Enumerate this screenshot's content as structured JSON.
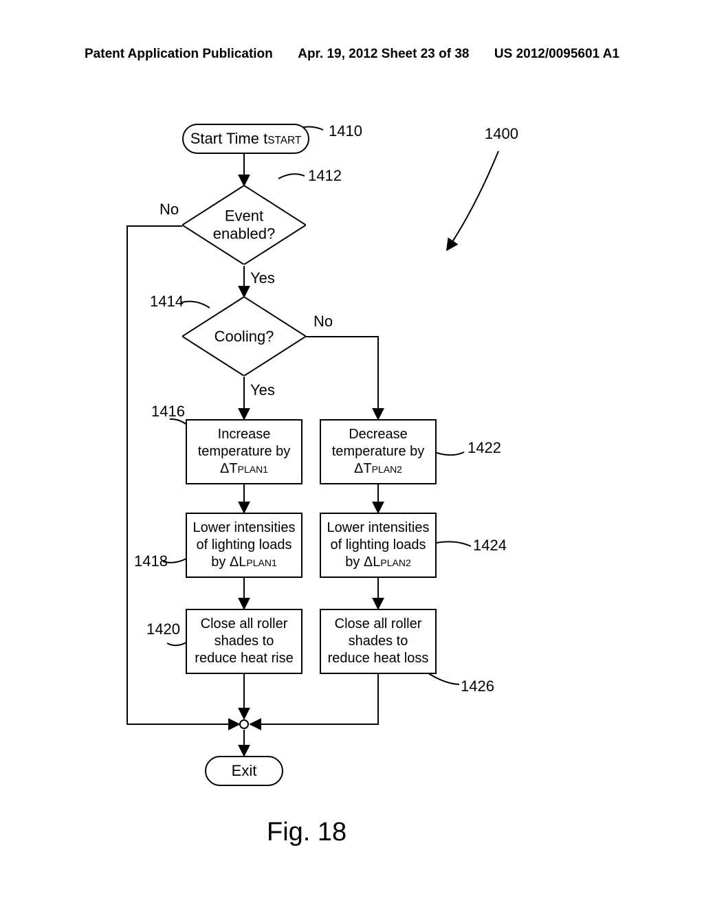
{
  "header": {
    "left": "Patent Application Publication",
    "mid": "Apr. 19, 2012  Sheet 23 of 38",
    "right": "US 2012/0095601 A1"
  },
  "refs": {
    "r1400": "1400",
    "r1410": "1410",
    "r1412": "1412",
    "r1414": "1414",
    "r1416": "1416",
    "r1418": "1418",
    "r1420": "1420",
    "r1422": "1422",
    "r1424": "1424",
    "r1426": "1426"
  },
  "edge_labels": {
    "event_no": "No",
    "event_yes": "Yes",
    "cooling_no": "No",
    "cooling_yes": "Yes"
  },
  "nodes": {
    "start_prefix": "Start Time t",
    "start_sub": "START",
    "event": "Event\nenabled?",
    "cooling": "Cooling?",
    "increase_l1": "Increase",
    "increase_l2": "temperature by",
    "increase_l3a": "ΔT",
    "increase_l3b": "PLAN1",
    "decrease_l1": "Decrease",
    "decrease_l2": "temperature by",
    "decrease_l3a": "ΔT",
    "decrease_l3b": "PLAN2",
    "lower1_l1": "Lower intensities",
    "lower1_l2": "of lighting loads",
    "lower1_l3a": "by ΔL",
    "lower1_l3b": "PLAN1",
    "lower2_l1": "Lower intensities",
    "lower2_l2": "of lighting loads",
    "lower2_l3a": "by ΔL",
    "lower2_l3b": "PLAN2",
    "close1_l1": "Close all roller",
    "close1_l2": "shades to",
    "close1_l3": "reduce heat rise",
    "close2_l1": "Close all roller",
    "close2_l2": "shades to",
    "close2_l3": "reduce heat loss",
    "exit": "Exit"
  },
  "figure_caption": "Fig. 18",
  "chart_data": {
    "type": "flowchart",
    "title": "Fig. 18",
    "figure_ref": "1400",
    "nodes": [
      {
        "id": "1410",
        "type": "terminal",
        "label": "Start Time t_START"
      },
      {
        "id": "1412",
        "type": "decision",
        "label": "Event enabled?"
      },
      {
        "id": "1414",
        "type": "decision",
        "label": "Cooling?"
      },
      {
        "id": "1416",
        "type": "process",
        "label": "Increase temperature by ΔT_PLAN1"
      },
      {
        "id": "1418",
        "type": "process",
        "label": "Lower intensities of lighting loads by ΔL_PLAN1"
      },
      {
        "id": "1420",
        "type": "process",
        "label": "Close all roller shades to reduce heat rise"
      },
      {
        "id": "1422",
        "type": "process",
        "label": "Decrease temperature by ΔT_PLAN2"
      },
      {
        "id": "1424",
        "type": "process",
        "label": "Lower intensities of lighting loads by ΔL_PLAN2"
      },
      {
        "id": "1426",
        "type": "process",
        "label": "Close all roller shades to reduce heat loss"
      },
      {
        "id": "junction",
        "type": "junction",
        "label": ""
      },
      {
        "id": "exit",
        "type": "terminal",
        "label": "Exit"
      }
    ],
    "edges": [
      {
        "from": "1410",
        "to": "1412",
        "label": ""
      },
      {
        "from": "1412",
        "to": "1414",
        "label": "Yes"
      },
      {
        "from": "1412",
        "to": "junction",
        "label": "No"
      },
      {
        "from": "1414",
        "to": "1416",
        "label": "Yes"
      },
      {
        "from": "1414",
        "to": "1422",
        "label": "No"
      },
      {
        "from": "1416",
        "to": "1418",
        "label": ""
      },
      {
        "from": "1418",
        "to": "1420",
        "label": ""
      },
      {
        "from": "1420",
        "to": "junction",
        "label": ""
      },
      {
        "from": "1422",
        "to": "1424",
        "label": ""
      },
      {
        "from": "1424",
        "to": "1426",
        "label": ""
      },
      {
        "from": "1426",
        "to": "junction",
        "label": ""
      },
      {
        "from": "junction",
        "to": "exit",
        "label": ""
      }
    ]
  }
}
